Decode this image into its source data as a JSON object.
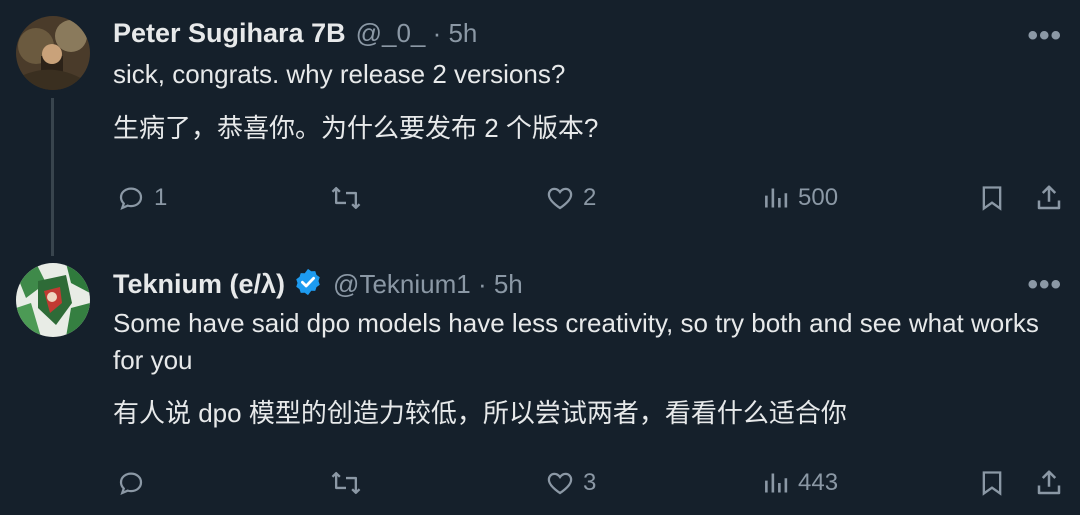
{
  "tweets": [
    {
      "author": "Peter Sugihara 7B",
      "meta": "@_0_ · 5h",
      "more": "•••",
      "text_en": "sick, congrats. why release 2 versions?",
      "text_zh": "生病了，恭喜你。为什么要发布 2 个版本?",
      "replies": "1",
      "retweets": "",
      "likes": "2",
      "views": "500"
    },
    {
      "author": "Teknium (e/λ)",
      "meta": "@Teknium1 · 5h",
      "more": "•••",
      "text_en": "Some have said dpo models have less creativity, so try both and see what works for you",
      "text_zh": "有人说 dpo 模型的创造力较低，所以尝试两者，看看什么适合你",
      "replies": "",
      "retweets": "",
      "likes": "3",
      "views": "443"
    }
  ],
  "colors": {
    "background": "#15202b",
    "text": "#e7e9ea",
    "muted": "#8b98a5",
    "verified": "#1d9bf0",
    "thread_line": "#38444d"
  },
  "icons": [
    "reply-icon",
    "retweet-icon",
    "like-icon",
    "views-icon",
    "bookmark-icon",
    "share-icon",
    "verified-badge-icon",
    "more-icon"
  ]
}
